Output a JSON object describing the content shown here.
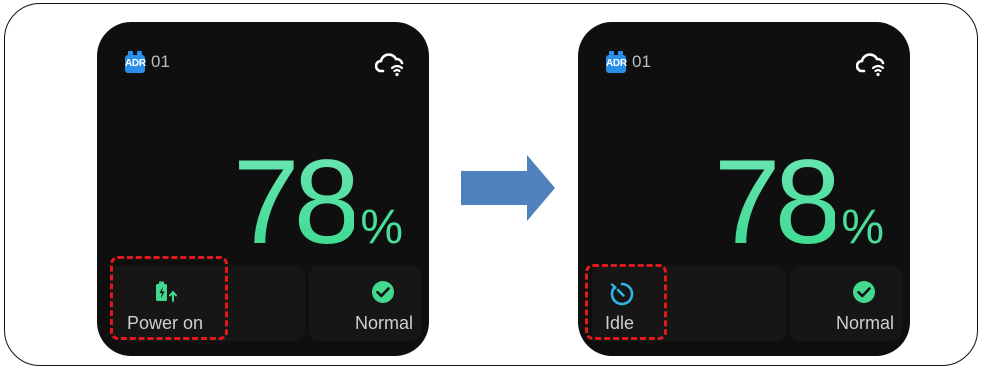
{
  "colors": {
    "accent_green": "#48de99",
    "badge_blue": "#2a8fe8",
    "status_blue": "#2fb6e8",
    "highlight_red": "#e0191c",
    "arrow_blue": "#4f81bd",
    "screen_bg": "#0f0f0f"
  },
  "panels": [
    {
      "badge": "ADR",
      "device_number": "01",
      "cloud_icon": "cloud-wifi-icon",
      "percentage": "78",
      "percent_sign": "%",
      "left_status": {
        "icon": "battery-charging-icon",
        "label": "Power on"
      },
      "right_status": {
        "icon": "check-circle-icon",
        "label": "Normal"
      }
    },
    {
      "badge": "ADR",
      "device_number": "01",
      "cloud_icon": "cloud-wifi-icon",
      "percentage": "78",
      "percent_sign": "%",
      "left_status": {
        "icon": "idle-timer-icon",
        "label": "Idle"
      },
      "right_status": {
        "icon": "check-circle-icon",
        "label": "Normal"
      }
    }
  ],
  "transition_arrow_icon": "arrow-right-icon"
}
